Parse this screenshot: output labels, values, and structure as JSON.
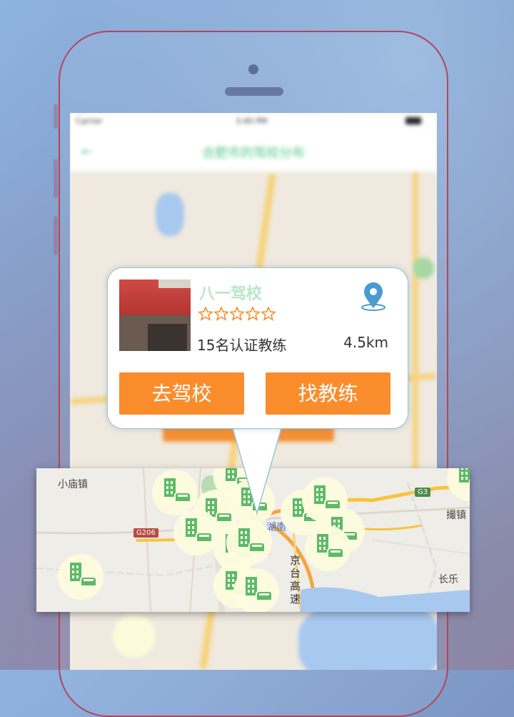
{
  "status_bar": {
    "carrier": "Carrier",
    "time": "3:40 PM"
  },
  "nav": {
    "title": "合肥市的驾校分布"
  },
  "popup": {
    "school_name": "八一驾校",
    "rating": 0,
    "rating_max": 5,
    "coach_count": "15名认证教练",
    "distance": "4.5km",
    "buttons": {
      "go_school": "去驾校",
      "find_coach": "找教练"
    }
  },
  "map": {
    "places": {
      "xiaomiao": "小庙镇",
      "chezhen": "撮镇",
      "changle": "长乐"
    },
    "road_shields": {
      "g206": "G206",
      "g3": "G3"
    },
    "road_label": "京台高速",
    "partial_label": "湖南"
  },
  "colors": {
    "accent_green": "#53c98a",
    "button_orange": "#f98d2c",
    "star_orange": "#f98d2c",
    "pin_blue": "#4a9ad4"
  },
  "icons": {
    "pin": "location-pin-icon",
    "star": "star-outline-icon",
    "cluster": "driving-school-marker-icon"
  }
}
